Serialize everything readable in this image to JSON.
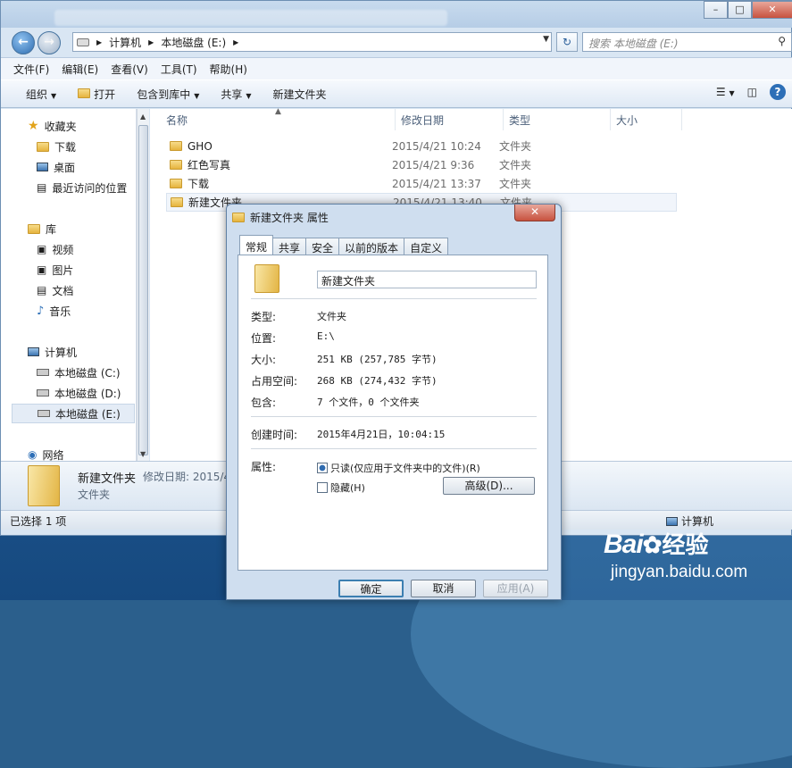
{
  "explorer": {
    "address_path": [
      "计算机",
      "本地磁盘 (E:)"
    ],
    "search_placeholder": "搜索 本地磁盘 (E:)",
    "menu": [
      "文件(F)",
      "编辑(E)",
      "查看(V)",
      "工具(T)",
      "帮助(H)"
    ],
    "toolbar": [
      "组织",
      "打开",
      "包含到库中",
      "共享",
      "新建文件夹"
    ],
    "sidebar": {
      "favorites": "收藏夹",
      "favorites_items": [
        "下载",
        "桌面",
        "最近访问的位置"
      ],
      "libraries": "库",
      "libraries_items": [
        "视频",
        "图片",
        "文档",
        "音乐"
      ],
      "computer": "计算机",
      "drives": [
        "本地磁盘 (C:)",
        "本地磁盘 (D:)",
        "本地磁盘 (E:)"
      ],
      "network": "网络"
    },
    "columns": [
      "名称",
      "修改日期",
      "类型",
      "大小"
    ],
    "files": [
      {
        "name": "GHO",
        "date": "2015/4/21 10:24",
        "type": "文件夹"
      },
      {
        "name": "红色写真",
        "date": "2015/4/21 9:36",
        "type": "文件夹"
      },
      {
        "name": "下载",
        "date": "2015/4/21 13:37",
        "type": "文件夹"
      },
      {
        "name": "新建文件夹",
        "date": "2015/4/21 13:40",
        "type": "文件夹"
      }
    ],
    "details": {
      "name": "新建文件夹",
      "modified_label": "修改日期: 2015/4",
      "type": "文件夹"
    },
    "status": "已选择 1 项",
    "status_right": "计算机"
  },
  "dialog": {
    "title": "新建文件夹 属性",
    "tabs": [
      "常规",
      "共享",
      "安全",
      "以前的版本",
      "自定义"
    ],
    "folder_name": "新建文件夹",
    "props": [
      {
        "label": "类型:",
        "value": "文件夹"
      },
      {
        "label": "位置:",
        "value": "E:\\"
      },
      {
        "label": "大小:",
        "value": "251 KB (257,785 字节)"
      },
      {
        "label": "占用空间:",
        "value": "268 KB (274,432 字节)"
      },
      {
        "label": "包含:",
        "value": "7 个文件，0 个文件夹"
      }
    ],
    "created_label": "创建时间:",
    "created_value": "2015年4月21日，10:04:15",
    "attr_label": "属性:",
    "readonly_label": "只读(仅应用于文件夹中的文件)(R)",
    "hidden_label": "隐藏(H)",
    "advanced_label": "高级(D)...",
    "ok": "确定",
    "cancel": "取消",
    "apply": "应用(A)"
  },
  "watermark": {
    "brand": "Bai",
    "brand2": "经验",
    "url": "jingyan.baidu.com"
  }
}
